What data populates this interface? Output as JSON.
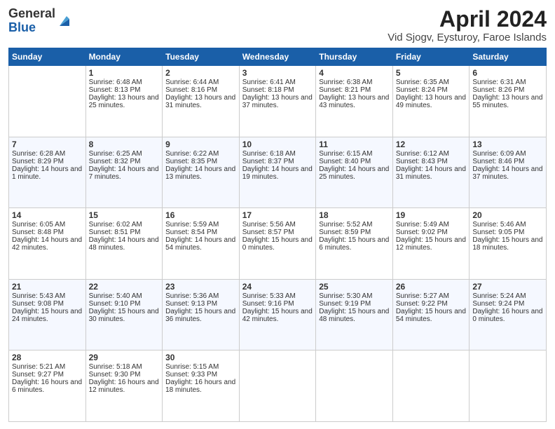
{
  "logo": {
    "general": "General",
    "blue": "Blue"
  },
  "title": "April 2024",
  "subtitle": "Vid Sjogv, Eysturoy, Faroe Islands",
  "days_header": [
    "Sunday",
    "Monday",
    "Tuesday",
    "Wednesday",
    "Thursday",
    "Friday",
    "Saturday"
  ],
  "weeks": [
    [
      {
        "day": "",
        "sunrise": "",
        "sunset": "",
        "daylight": ""
      },
      {
        "day": "1",
        "sunrise": "Sunrise: 6:48 AM",
        "sunset": "Sunset: 8:13 PM",
        "daylight": "Daylight: 13 hours and 25 minutes."
      },
      {
        "day": "2",
        "sunrise": "Sunrise: 6:44 AM",
        "sunset": "Sunset: 8:16 PM",
        "daylight": "Daylight: 13 hours and 31 minutes."
      },
      {
        "day": "3",
        "sunrise": "Sunrise: 6:41 AM",
        "sunset": "Sunset: 8:18 PM",
        "daylight": "Daylight: 13 hours and 37 minutes."
      },
      {
        "day": "4",
        "sunrise": "Sunrise: 6:38 AM",
        "sunset": "Sunset: 8:21 PM",
        "daylight": "Daylight: 13 hours and 43 minutes."
      },
      {
        "day": "5",
        "sunrise": "Sunrise: 6:35 AM",
        "sunset": "Sunset: 8:24 PM",
        "daylight": "Daylight: 13 hours and 49 minutes."
      },
      {
        "day": "6",
        "sunrise": "Sunrise: 6:31 AM",
        "sunset": "Sunset: 8:26 PM",
        "daylight": "Daylight: 13 hours and 55 minutes."
      }
    ],
    [
      {
        "day": "7",
        "sunrise": "Sunrise: 6:28 AM",
        "sunset": "Sunset: 8:29 PM",
        "daylight": "Daylight: 14 hours and 1 minute."
      },
      {
        "day": "8",
        "sunrise": "Sunrise: 6:25 AM",
        "sunset": "Sunset: 8:32 PM",
        "daylight": "Daylight: 14 hours and 7 minutes."
      },
      {
        "day": "9",
        "sunrise": "Sunrise: 6:22 AM",
        "sunset": "Sunset: 8:35 PM",
        "daylight": "Daylight: 14 hours and 13 minutes."
      },
      {
        "day": "10",
        "sunrise": "Sunrise: 6:18 AM",
        "sunset": "Sunset: 8:37 PM",
        "daylight": "Daylight: 14 hours and 19 minutes."
      },
      {
        "day": "11",
        "sunrise": "Sunrise: 6:15 AM",
        "sunset": "Sunset: 8:40 PM",
        "daylight": "Daylight: 14 hours and 25 minutes."
      },
      {
        "day": "12",
        "sunrise": "Sunrise: 6:12 AM",
        "sunset": "Sunset: 8:43 PM",
        "daylight": "Daylight: 14 hours and 31 minutes."
      },
      {
        "day": "13",
        "sunrise": "Sunrise: 6:09 AM",
        "sunset": "Sunset: 8:46 PM",
        "daylight": "Daylight: 14 hours and 37 minutes."
      }
    ],
    [
      {
        "day": "14",
        "sunrise": "Sunrise: 6:05 AM",
        "sunset": "Sunset: 8:48 PM",
        "daylight": "Daylight: 14 hours and 42 minutes."
      },
      {
        "day": "15",
        "sunrise": "Sunrise: 6:02 AM",
        "sunset": "Sunset: 8:51 PM",
        "daylight": "Daylight: 14 hours and 48 minutes."
      },
      {
        "day": "16",
        "sunrise": "Sunrise: 5:59 AM",
        "sunset": "Sunset: 8:54 PM",
        "daylight": "Daylight: 14 hours and 54 minutes."
      },
      {
        "day": "17",
        "sunrise": "Sunrise: 5:56 AM",
        "sunset": "Sunset: 8:57 PM",
        "daylight": "Daylight: 15 hours and 0 minutes."
      },
      {
        "day": "18",
        "sunrise": "Sunrise: 5:52 AM",
        "sunset": "Sunset: 8:59 PM",
        "daylight": "Daylight: 15 hours and 6 minutes."
      },
      {
        "day": "19",
        "sunrise": "Sunrise: 5:49 AM",
        "sunset": "Sunset: 9:02 PM",
        "daylight": "Daylight: 15 hours and 12 minutes."
      },
      {
        "day": "20",
        "sunrise": "Sunrise: 5:46 AM",
        "sunset": "Sunset: 9:05 PM",
        "daylight": "Daylight: 15 hours and 18 minutes."
      }
    ],
    [
      {
        "day": "21",
        "sunrise": "Sunrise: 5:43 AM",
        "sunset": "Sunset: 9:08 PM",
        "daylight": "Daylight: 15 hours and 24 minutes."
      },
      {
        "day": "22",
        "sunrise": "Sunrise: 5:40 AM",
        "sunset": "Sunset: 9:10 PM",
        "daylight": "Daylight: 15 hours and 30 minutes."
      },
      {
        "day": "23",
        "sunrise": "Sunrise: 5:36 AM",
        "sunset": "Sunset: 9:13 PM",
        "daylight": "Daylight: 15 hours and 36 minutes."
      },
      {
        "day": "24",
        "sunrise": "Sunrise: 5:33 AM",
        "sunset": "Sunset: 9:16 PM",
        "daylight": "Daylight: 15 hours and 42 minutes."
      },
      {
        "day": "25",
        "sunrise": "Sunrise: 5:30 AM",
        "sunset": "Sunset: 9:19 PM",
        "daylight": "Daylight: 15 hours and 48 minutes."
      },
      {
        "day": "26",
        "sunrise": "Sunrise: 5:27 AM",
        "sunset": "Sunset: 9:22 PM",
        "daylight": "Daylight: 15 hours and 54 minutes."
      },
      {
        "day": "27",
        "sunrise": "Sunrise: 5:24 AM",
        "sunset": "Sunset: 9:24 PM",
        "daylight": "Daylight: 16 hours and 0 minutes."
      }
    ],
    [
      {
        "day": "28",
        "sunrise": "Sunrise: 5:21 AM",
        "sunset": "Sunset: 9:27 PM",
        "daylight": "Daylight: 16 hours and 6 minutes."
      },
      {
        "day": "29",
        "sunrise": "Sunrise: 5:18 AM",
        "sunset": "Sunset: 9:30 PM",
        "daylight": "Daylight: 16 hours and 12 minutes."
      },
      {
        "day": "30",
        "sunrise": "Sunrise: 5:15 AM",
        "sunset": "Sunset: 9:33 PM",
        "daylight": "Daylight: 16 hours and 18 minutes."
      },
      {
        "day": "",
        "sunrise": "",
        "sunset": "",
        "daylight": ""
      },
      {
        "day": "",
        "sunrise": "",
        "sunset": "",
        "daylight": ""
      },
      {
        "day": "",
        "sunrise": "",
        "sunset": "",
        "daylight": ""
      },
      {
        "day": "",
        "sunrise": "",
        "sunset": "",
        "daylight": ""
      }
    ]
  ]
}
